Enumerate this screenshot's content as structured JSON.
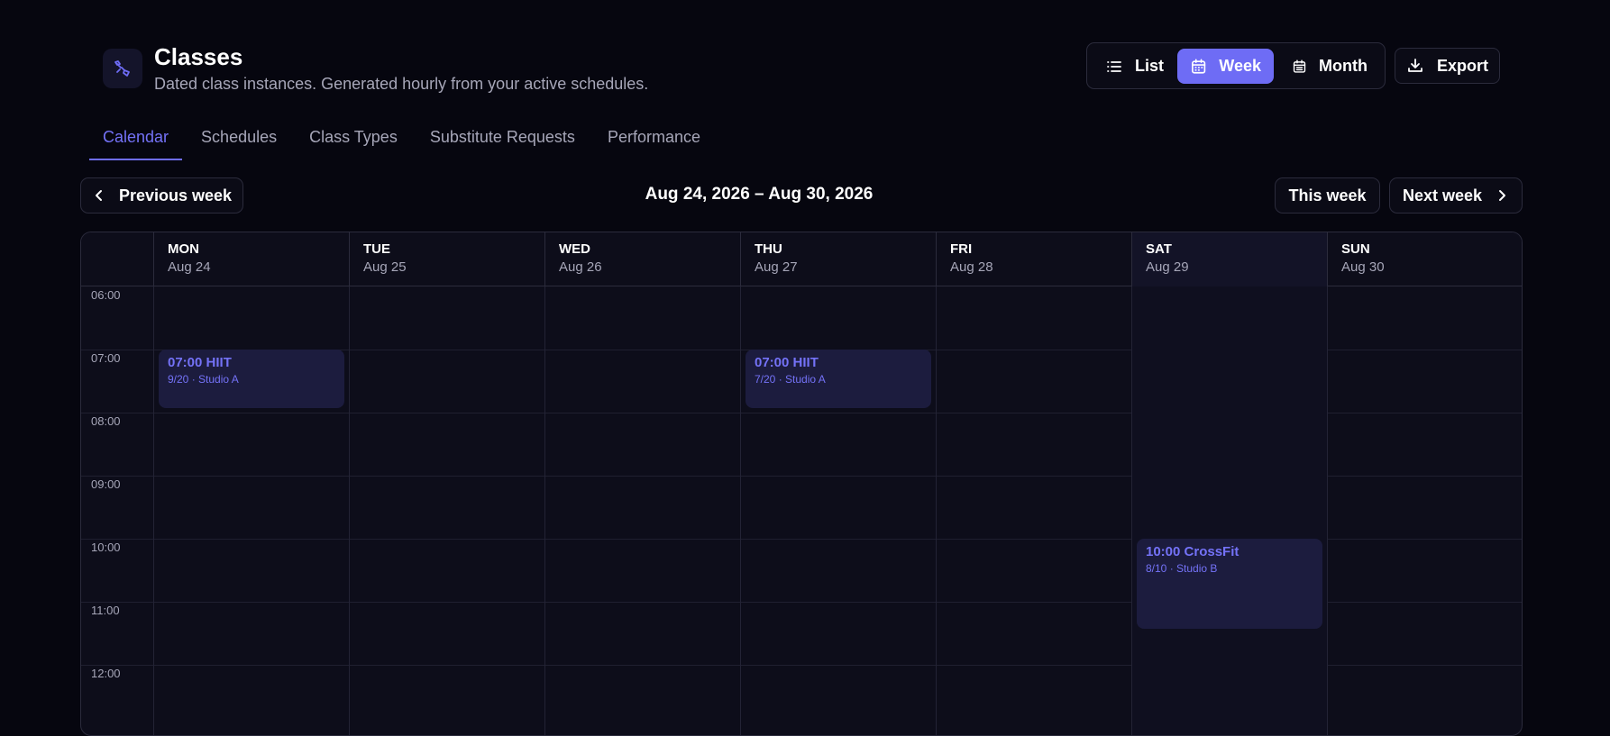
{
  "header": {
    "title": "Classes",
    "subtitle": "Dated class instances. Generated hourly from your active schedules.",
    "views": [
      {
        "label": "List",
        "icon": "list-icon",
        "active": false
      },
      {
        "label": "Week",
        "icon": "calendar-icon",
        "active": true
      },
      {
        "label": "Month",
        "icon": "calendar-month-icon",
        "active": false
      }
    ],
    "export_label": "Export"
  },
  "tabs": [
    {
      "label": "Calendar",
      "active": true
    },
    {
      "label": "Schedules",
      "active": false
    },
    {
      "label": "Class Types",
      "active": false
    },
    {
      "label": "Substitute Requests",
      "active": false
    },
    {
      "label": "Performance",
      "active": false
    }
  ],
  "week_nav": {
    "previous_label": "Previous week",
    "range": "Aug 24, 2026 – Aug 30, 2026",
    "this_week_label": "This week",
    "next_label": "Next week"
  },
  "calendar": {
    "days": [
      {
        "dow": "MON",
        "date": "Aug 24"
      },
      {
        "dow": "TUE",
        "date": "Aug 25"
      },
      {
        "dow": "WED",
        "date": "Aug 26"
      },
      {
        "dow": "THU",
        "date": "Aug 27"
      },
      {
        "dow": "FRI",
        "date": "Aug 28"
      },
      {
        "dow": "SAT",
        "date": "Aug 29"
      },
      {
        "dow": "SUN",
        "date": "Aug 30"
      }
    ],
    "hours": [
      "06:00",
      "07:00",
      "08:00",
      "09:00",
      "10:00",
      "11:00",
      "12:00"
    ],
    "events": [
      {
        "title": "07:00 HIIT",
        "detail": "9/20 · Studio A"
      },
      {
        "title": "07:00 HIIT",
        "detail": "7/20 · Studio A"
      },
      {
        "title": "10:00 CrossFit",
        "detail": "8/10 · Studio B"
      }
    ]
  }
}
